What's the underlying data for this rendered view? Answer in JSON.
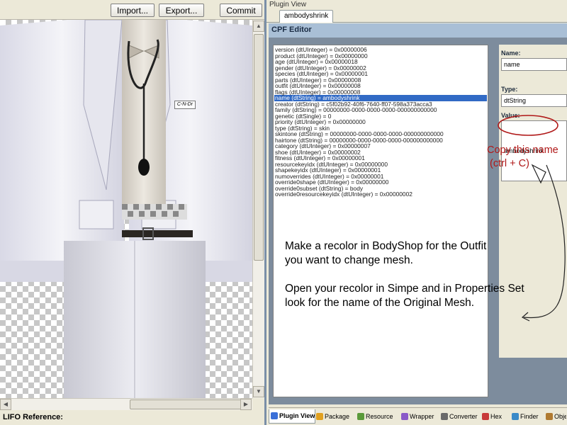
{
  "left": {
    "toolbar": {
      "import_label": "Import...",
      "export_label": "Export...",
      "commit_label": "Commit"
    },
    "badge_text": "C-N-Dr",
    "footer_label": "LIFO Reference:"
  },
  "right": {
    "pane_title": "Plugin View",
    "open_tab": "ambodyshrink",
    "editor_title": "CPF Editor",
    "properties": [
      "version (dtUInteger) = 0x00000006",
      "product (dtUInteger) = 0x00000000",
      "age (dtUInteger) = 0x00000018",
      "gender (dtUInteger) = 0x00000002",
      "species (dtUInteger) = 0x00000001",
      "parts (dtUInteger) = 0x00000008",
      "outfit (dtUInteger) = 0x00000008",
      "flags (dtUInteger) = 0x00000008",
      "name (dtString) = ambodyshrink",
      "creator (dtString) = c5f02b92-40f6-7640-ff07-598a373acca3",
      "family (dtString) = 00000000-0000-0000-0000-000000000000",
      "genetic (dtSingle) = 0",
      "priority (dtUInteger) = 0x00000000",
      "type (dtString) = skin",
      "skintone (dtString) = 00000000-0000-0000-0000-000000000000",
      "hairtone (dtString) = 00000000-0000-0000-0000-000000000000",
      "category (dtUInteger) = 0x00000007",
      "shoe (dtUInteger) = 0x00000002",
      "fitness (dtUInteger) = 0x00000001",
      "resourcekeyidx (dtUInteger) = 0x00000000",
      "shapekeyidx (dtUInteger) = 0x00000001",
      "numoverrides (dtUInteger) = 0x00000001",
      "override0shape (dtUInteger) = 0x00000000",
      "override0subset (dtString) = body",
      "override0resourcekeyidx (dtUInteger) = 0x00000002"
    ],
    "selected_index": 8,
    "fields": {
      "name_label": "Name:",
      "name_value": "name",
      "type_label": "Type:",
      "type_value": "dtString",
      "value_label": "Value:",
      "value_value": "ambodyshrink"
    },
    "annotation": {
      "line1": "Copy this name",
      "line2": "(ctrl + C)"
    },
    "instructions": {
      "para1_line1": "Make a recolor in BodyShop for the Outfit",
      "para1_line2": "you want to change mesh.",
      "para2_line1": "Open your recolor in Simpe and in Properties Set",
      "para2_line2": "look for the name of the Original Mesh."
    },
    "bottom_tabs": [
      {
        "label": "Plugin View",
        "icon": "plugin-icon",
        "color": "#3a6fd8"
      },
      {
        "label": "Package",
        "icon": "package-icon",
        "color": "#e0a020"
      },
      {
        "label": "Resource",
        "icon": "resource-icon",
        "color": "#5a9a3a"
      },
      {
        "label": "Wrapper",
        "icon": "wrapper-icon",
        "color": "#8a5ac8"
      },
      {
        "label": "Converter",
        "icon": "converter-icon",
        "color": "#6a6a6a"
      },
      {
        "label": "Hex",
        "icon": "hex-icon",
        "color": "#c83a3a"
      },
      {
        "label": "Finder",
        "icon": "finder-icon",
        "color": "#3a8ac8"
      },
      {
        "label": "Object Workshop",
        "icon": "workshop-icon",
        "color": "#b07a30"
      }
    ]
  },
  "colors": {
    "accent_blue": "#316ac5",
    "annotation_red": "#b01818",
    "editor_header": "#a9bfd6"
  }
}
